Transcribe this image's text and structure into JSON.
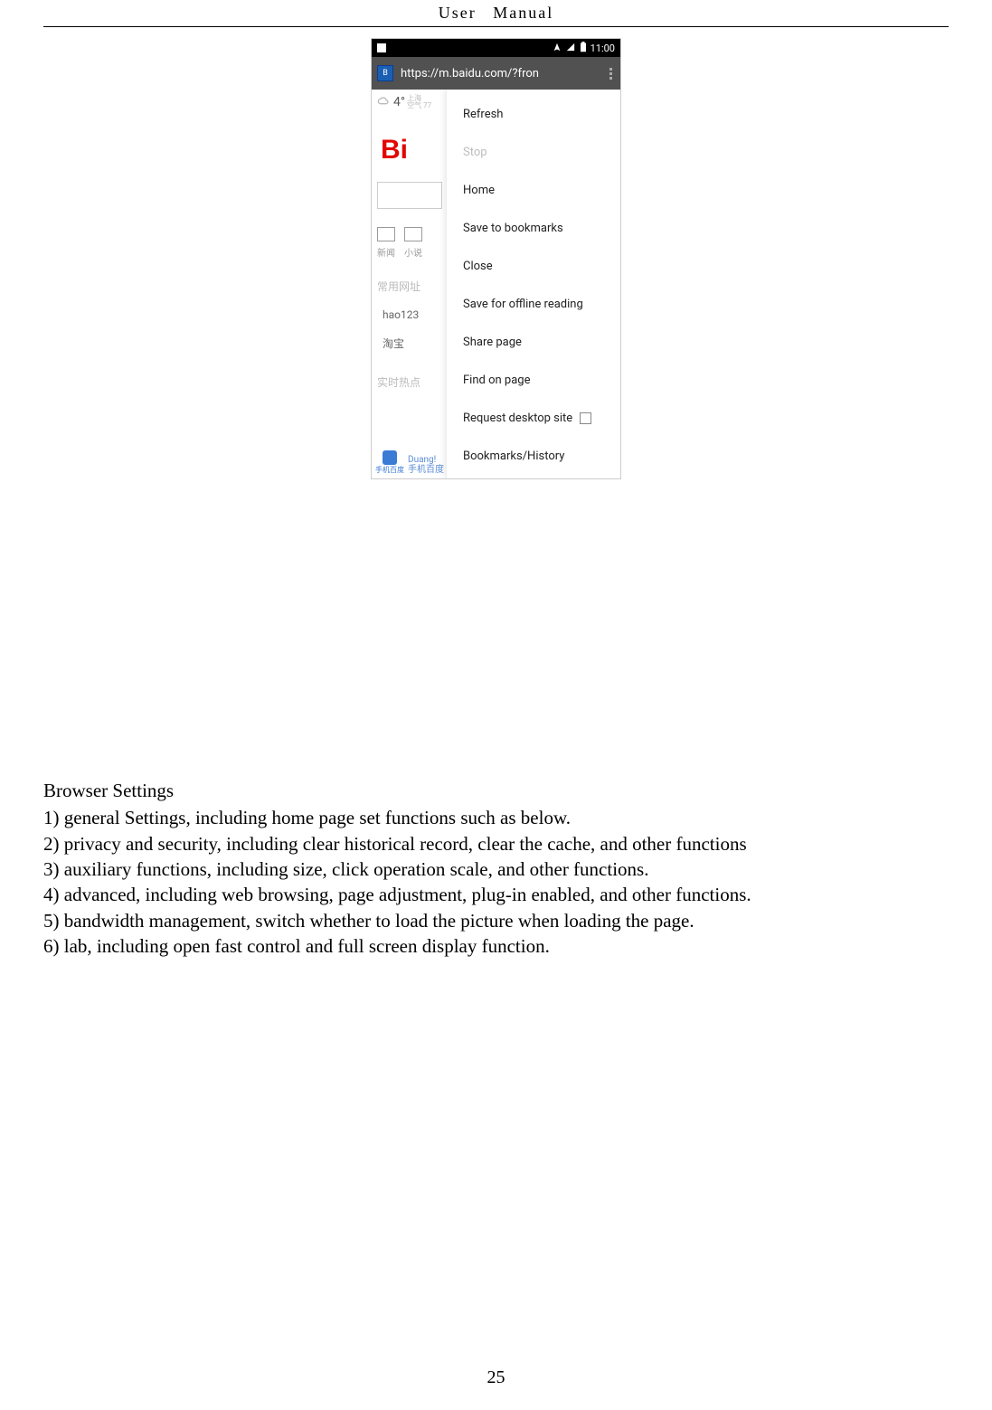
{
  "doc_header": {
    "word1": "User",
    "word2": "Manual"
  },
  "page_number": "25",
  "settings_section": {
    "title": "Browser Settings",
    "items": [
      "1) general Settings, including home page set functions such as below.",
      "2) privacy and security, including clear historical record, clear the cache, and other functions",
      "3) auxiliary functions, including size, click operation scale, and other functions.",
      "4) advanced, including web browsing, page adjustment, plug-in enabled, and other functions.",
      "5) bandwidth management, switch whether to load the picture when loading the page.",
      "6) lab, including open fast control and full screen display function."
    ]
  },
  "phone": {
    "status_time": "11:00",
    "url": "https://m.baidu.com/?fron",
    "menu": {
      "refresh": "Refresh",
      "stop": "Stop",
      "home": "Home",
      "save_bookmarks": "Save to bookmarks",
      "close": "Close",
      "save_offline": "Save for offline reading",
      "share": "Share page",
      "find": "Find on page",
      "desktop": "Request desktop site",
      "bookmarks_history": "Bookmarks/History"
    },
    "left": {
      "temp": "4°",
      "city": "上海",
      "aqi": "空气 77",
      "logo_fragment": "Bi",
      "tab_news": "新闻",
      "tab_novel": "小说",
      "section_common": "常用网址",
      "link_hao123": "hao123",
      "link_taobao": "淘宝",
      "section_hot": "实时热点",
      "paw_label": "手机百度",
      "duang_line1": "Duang!",
      "duang_line2": "手机百度"
    }
  }
}
